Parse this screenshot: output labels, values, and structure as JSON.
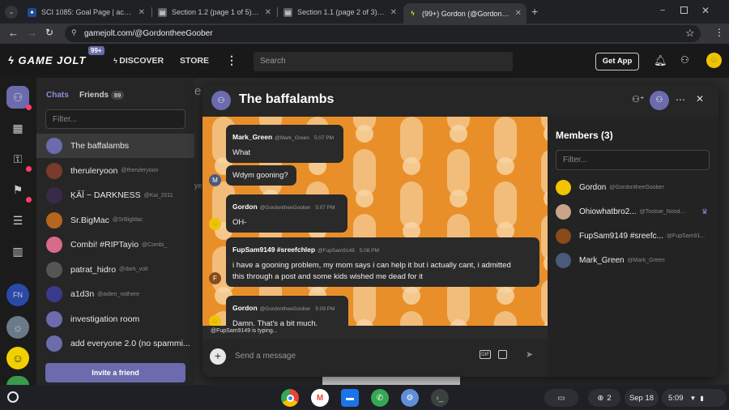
{
  "browser": {
    "tabs": [
      {
        "label": "SCI 1085: Goal Page | acecon",
        "icon": "school-icon"
      },
      {
        "label": "Section 1.2 (page 1 of 5) | ace",
        "icon": "doc-icon"
      },
      {
        "label": "Section 1.1 (page 2 of 3) | ace",
        "icon": "doc-icon"
      },
      {
        "label": "(99+) Gordon (@GordontheeGo",
        "icon": "gamejolt-icon"
      }
    ],
    "url": "gamejolt.com/@GordontheeGoober"
  },
  "header": {
    "logo": "GAME JOLT",
    "badge": "99+",
    "discover": "DISCOVER",
    "store": "STORE",
    "search_placeholder": "Search",
    "get_app": "Get App"
  },
  "chats": {
    "tab_chats": "Chats",
    "tab_friends": "Friends",
    "friends_count": "89",
    "filter_placeholder": "Filter...",
    "items": [
      {
        "name": "The baffalambs",
        "handle": "",
        "color": "#6b6bad"
      },
      {
        "name": "theruleryoon",
        "handle": "@theruleryoon",
        "color": "#7a3a2a"
      },
      {
        "name": "ĶĂĬ ~ DARKNESS",
        "handle": "@Kai_2011",
        "color": "#3a2a4a"
      },
      {
        "name": "Sr.BigMac",
        "handle": "@SrBigMac",
        "color": "#b5651d"
      },
      {
        "name": "Combi! #RIPTayio",
        "handle": "@Combi_",
        "color": "#d86a8a"
      },
      {
        "name": "patrat_hidro",
        "handle": "@dark_volt",
        "color": "#555555"
      },
      {
        "name": "a1d3n",
        "handle": "@aiden_nothere",
        "color": "#3a3a8a"
      },
      {
        "name": "investigation room",
        "handle": "",
        "color": "#6b6bad"
      },
      {
        "name": "add everyone 2.0 (no spammi...",
        "handle": "",
        "color": "#6b6bad"
      }
    ],
    "invite": "Invite a friend"
  },
  "room": {
    "title": "The baffalambs",
    "messages": [
      {
        "author": "Mark_Green",
        "handle": "@Mark_Green",
        "time": "5:07 PM",
        "lines": [
          "What"
        ]
      },
      {
        "author": "",
        "handle": "",
        "time": "",
        "lines": [
          "Wdym gooning?"
        ]
      },
      {
        "author": "Gordon",
        "handle": "@GordontheeGoober",
        "time": "5:07 PM",
        "lines": [
          "OH-"
        ]
      },
      {
        "author": "FupSam9149 #sreefchlep",
        "handle": "@FupSam9149",
        "time": "5:08 PM",
        "lines": [
          "i have a gooning problem, my mom says i can help it but i actually cant, i admitted",
          "this through a post and some kids wished me dead for it"
        ]
      },
      {
        "author": "Gordon",
        "handle": "@GordontheeGoober",
        "time": "5:09 PM",
        "lines": [
          "Damn. That's a bit much."
        ]
      }
    ],
    "typing": "@FupSam9149 is typing...",
    "composer_placeholder": "Send a message"
  },
  "members": {
    "title": "Members (3)",
    "filter_placeholder": "Filter...",
    "list": [
      {
        "name": "Gordon",
        "handle": "@GordontheeGoober",
        "color": "#f2c400"
      },
      {
        "name": "Ohiowhatbro2...",
        "handle": "@Tootsie_Nood...",
        "color": "#c9a48a"
      },
      {
        "name": "FupSam9149 #sreefc...",
        "handle": "@FupSam91...",
        "color": "#8a4a1a"
      },
      {
        "name": "Mark_Green",
        "handle": "@Mark_Green",
        "color": "#4a5a7a"
      }
    ]
  },
  "shelf": {
    "notif_count": "2",
    "date": "Sep 18",
    "time": "5:09"
  }
}
